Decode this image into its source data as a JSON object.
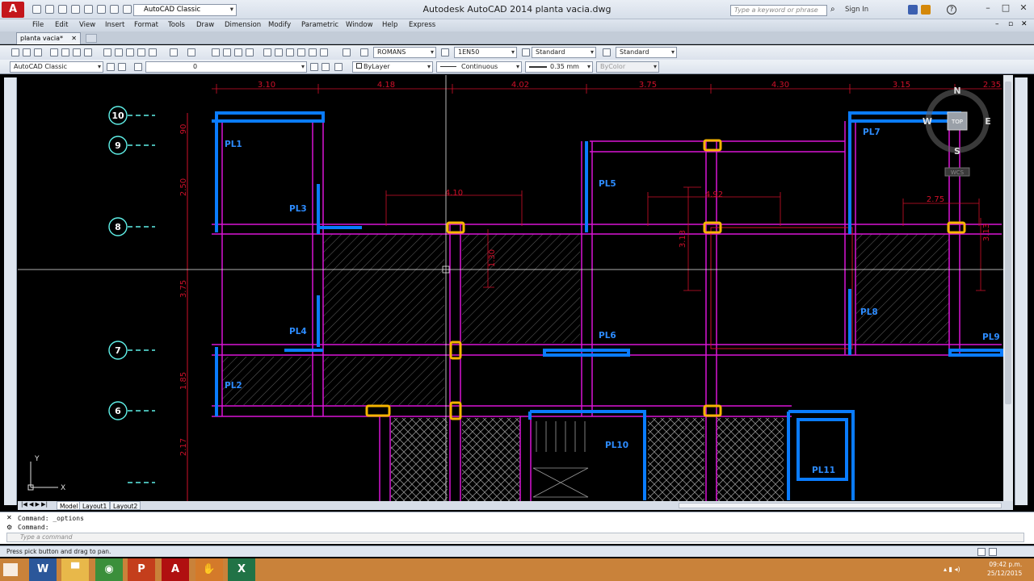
{
  "window": {
    "app_logo": "A",
    "title": "Autodesk AutoCAD 2014     planta vacia.dwg",
    "workspace": "AutoCAD Classic",
    "search_placeholder": "Type a keyword or phrase",
    "sign_in": "Sign In",
    "minimize": "–",
    "maximize": "□",
    "close": "✕"
  },
  "menu": [
    "File",
    "Edit",
    "View",
    "Insert",
    "Format",
    "Tools",
    "Draw",
    "Dimension",
    "Modify",
    "Parametric",
    "Window",
    "Help",
    "Express"
  ],
  "doc_tab": "planta vacia*",
  "styles_toolbar": {
    "text_style": "ROMANS",
    "dim_style": "1EN50",
    "table_style": "Standard",
    "multileader_style": "Standard"
  },
  "layers_toolbar": {
    "workspace": "AutoCAD Classic",
    "layer": "0",
    "color": "ByLayer",
    "linetype": "Continuous",
    "lineweight": "0.35 mm",
    "plot_style": "ByColor"
  },
  "drawing": {
    "top_dimensions": [
      "3.10",
      "4.18",
      "4.02",
      "3.75",
      "4.30",
      "3.15",
      "2.35"
    ],
    "left_dimensions": [
      "90",
      "2.50",
      "3.75",
      "1.85",
      "2.17"
    ],
    "inner_dimensions": [
      "4.10",
      "4.92",
      "2.75",
      "3.13",
      "1.30",
      "3.13"
    ],
    "axes": [
      "10",
      "9",
      "8",
      "7",
      "6"
    ],
    "columns": [
      "PL1",
      "PL3",
      "PL5",
      "PL7",
      "PL4",
      "PL6",
      "PL8",
      "PL9",
      "PL2",
      "PL10",
      "PL11"
    ],
    "viewcube": {
      "north": "N",
      "south": "S",
      "east": "E",
      "west": "W",
      "top": "TOP",
      "wcs": "WCS"
    },
    "ucs": {
      "x": "X",
      "y": "Y"
    },
    "colors": {
      "wall": "#d914d6",
      "column": "#0a7cff",
      "beam": "#f5b400",
      "dimension": "#d0102a",
      "axis": "#5ff0e8",
      "hatch": "#8c8c8c"
    }
  },
  "layout_tabs": [
    "Model",
    "Layout1",
    "Layout2"
  ],
  "command_lines": [
    "Command:  _options",
    "Command:"
  ],
  "command_placeholder": "Type a command",
  "status_text": "Press pick button and drag to pan.",
  "clock": {
    "time": "09:42 p.m.",
    "date": "25/12/2015"
  },
  "taskbar_apps": [
    {
      "name": "word-icon",
      "label": "W",
      "color": "#2b579a"
    },
    {
      "name": "explorer-icon",
      "label": "▀",
      "color": "#e8b84a"
    },
    {
      "name": "chrome-icon",
      "label": "◉",
      "color": "#3b8f3b"
    },
    {
      "name": "powerpoint-icon",
      "label": "P",
      "color": "#c43e1c"
    },
    {
      "name": "autocad-icon",
      "label": "A",
      "color": "#b01010"
    },
    {
      "name": "hand-icon",
      "label": "✋",
      "color": "#d47a2a"
    },
    {
      "name": "excel-icon",
      "label": "X",
      "color": "#217346"
    }
  ]
}
